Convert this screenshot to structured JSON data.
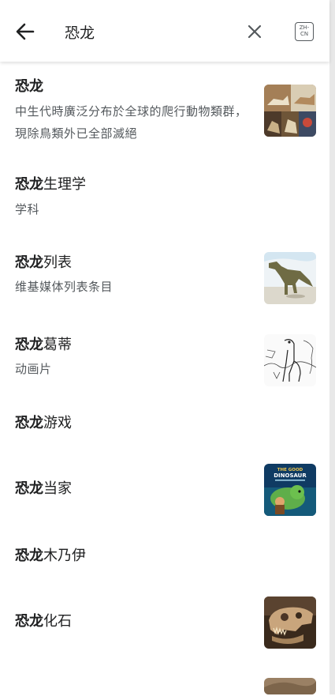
{
  "search": {
    "query": "恐龙",
    "lang_line1": "ZH-",
    "lang_line2": "CN"
  },
  "results": [
    {
      "bold": "恐龙",
      "rest": "",
      "desc": "中生代時廣泛分布於全球的爬行動物類群，現除鳥類外已全部滅絕",
      "thumb": "dinosaur-collage"
    },
    {
      "bold": "恐龙",
      "rest": "生理学",
      "desc": "学科",
      "thumb": ""
    },
    {
      "bold": "恐龙",
      "rest": "列表",
      "desc": "维基媒体列表条目",
      "thumb": "dinosaur-illustration"
    },
    {
      "bold": "恐龙",
      "rest": "葛蒂",
      "desc": "动画片",
      "thumb": "gertie-sketch"
    },
    {
      "bold": "恐龙",
      "rest": "游戏",
      "desc": "",
      "thumb": ""
    },
    {
      "bold": "恐龙",
      "rest": "当家",
      "desc": "",
      "thumb": "good-dinosaur-poster"
    },
    {
      "bold": "恐龙",
      "rest": "木乃伊",
      "desc": "",
      "thumb": ""
    },
    {
      "bold": "恐龙",
      "rest": "化石",
      "desc": "",
      "thumb": "dinosaur-skull"
    }
  ],
  "poster": {
    "line1": "THE GOOD",
    "line2": "DINOSAUR"
  },
  "colors": {
    "title": "#202122",
    "desc": "#54595d",
    "icon": "#54595d"
  }
}
